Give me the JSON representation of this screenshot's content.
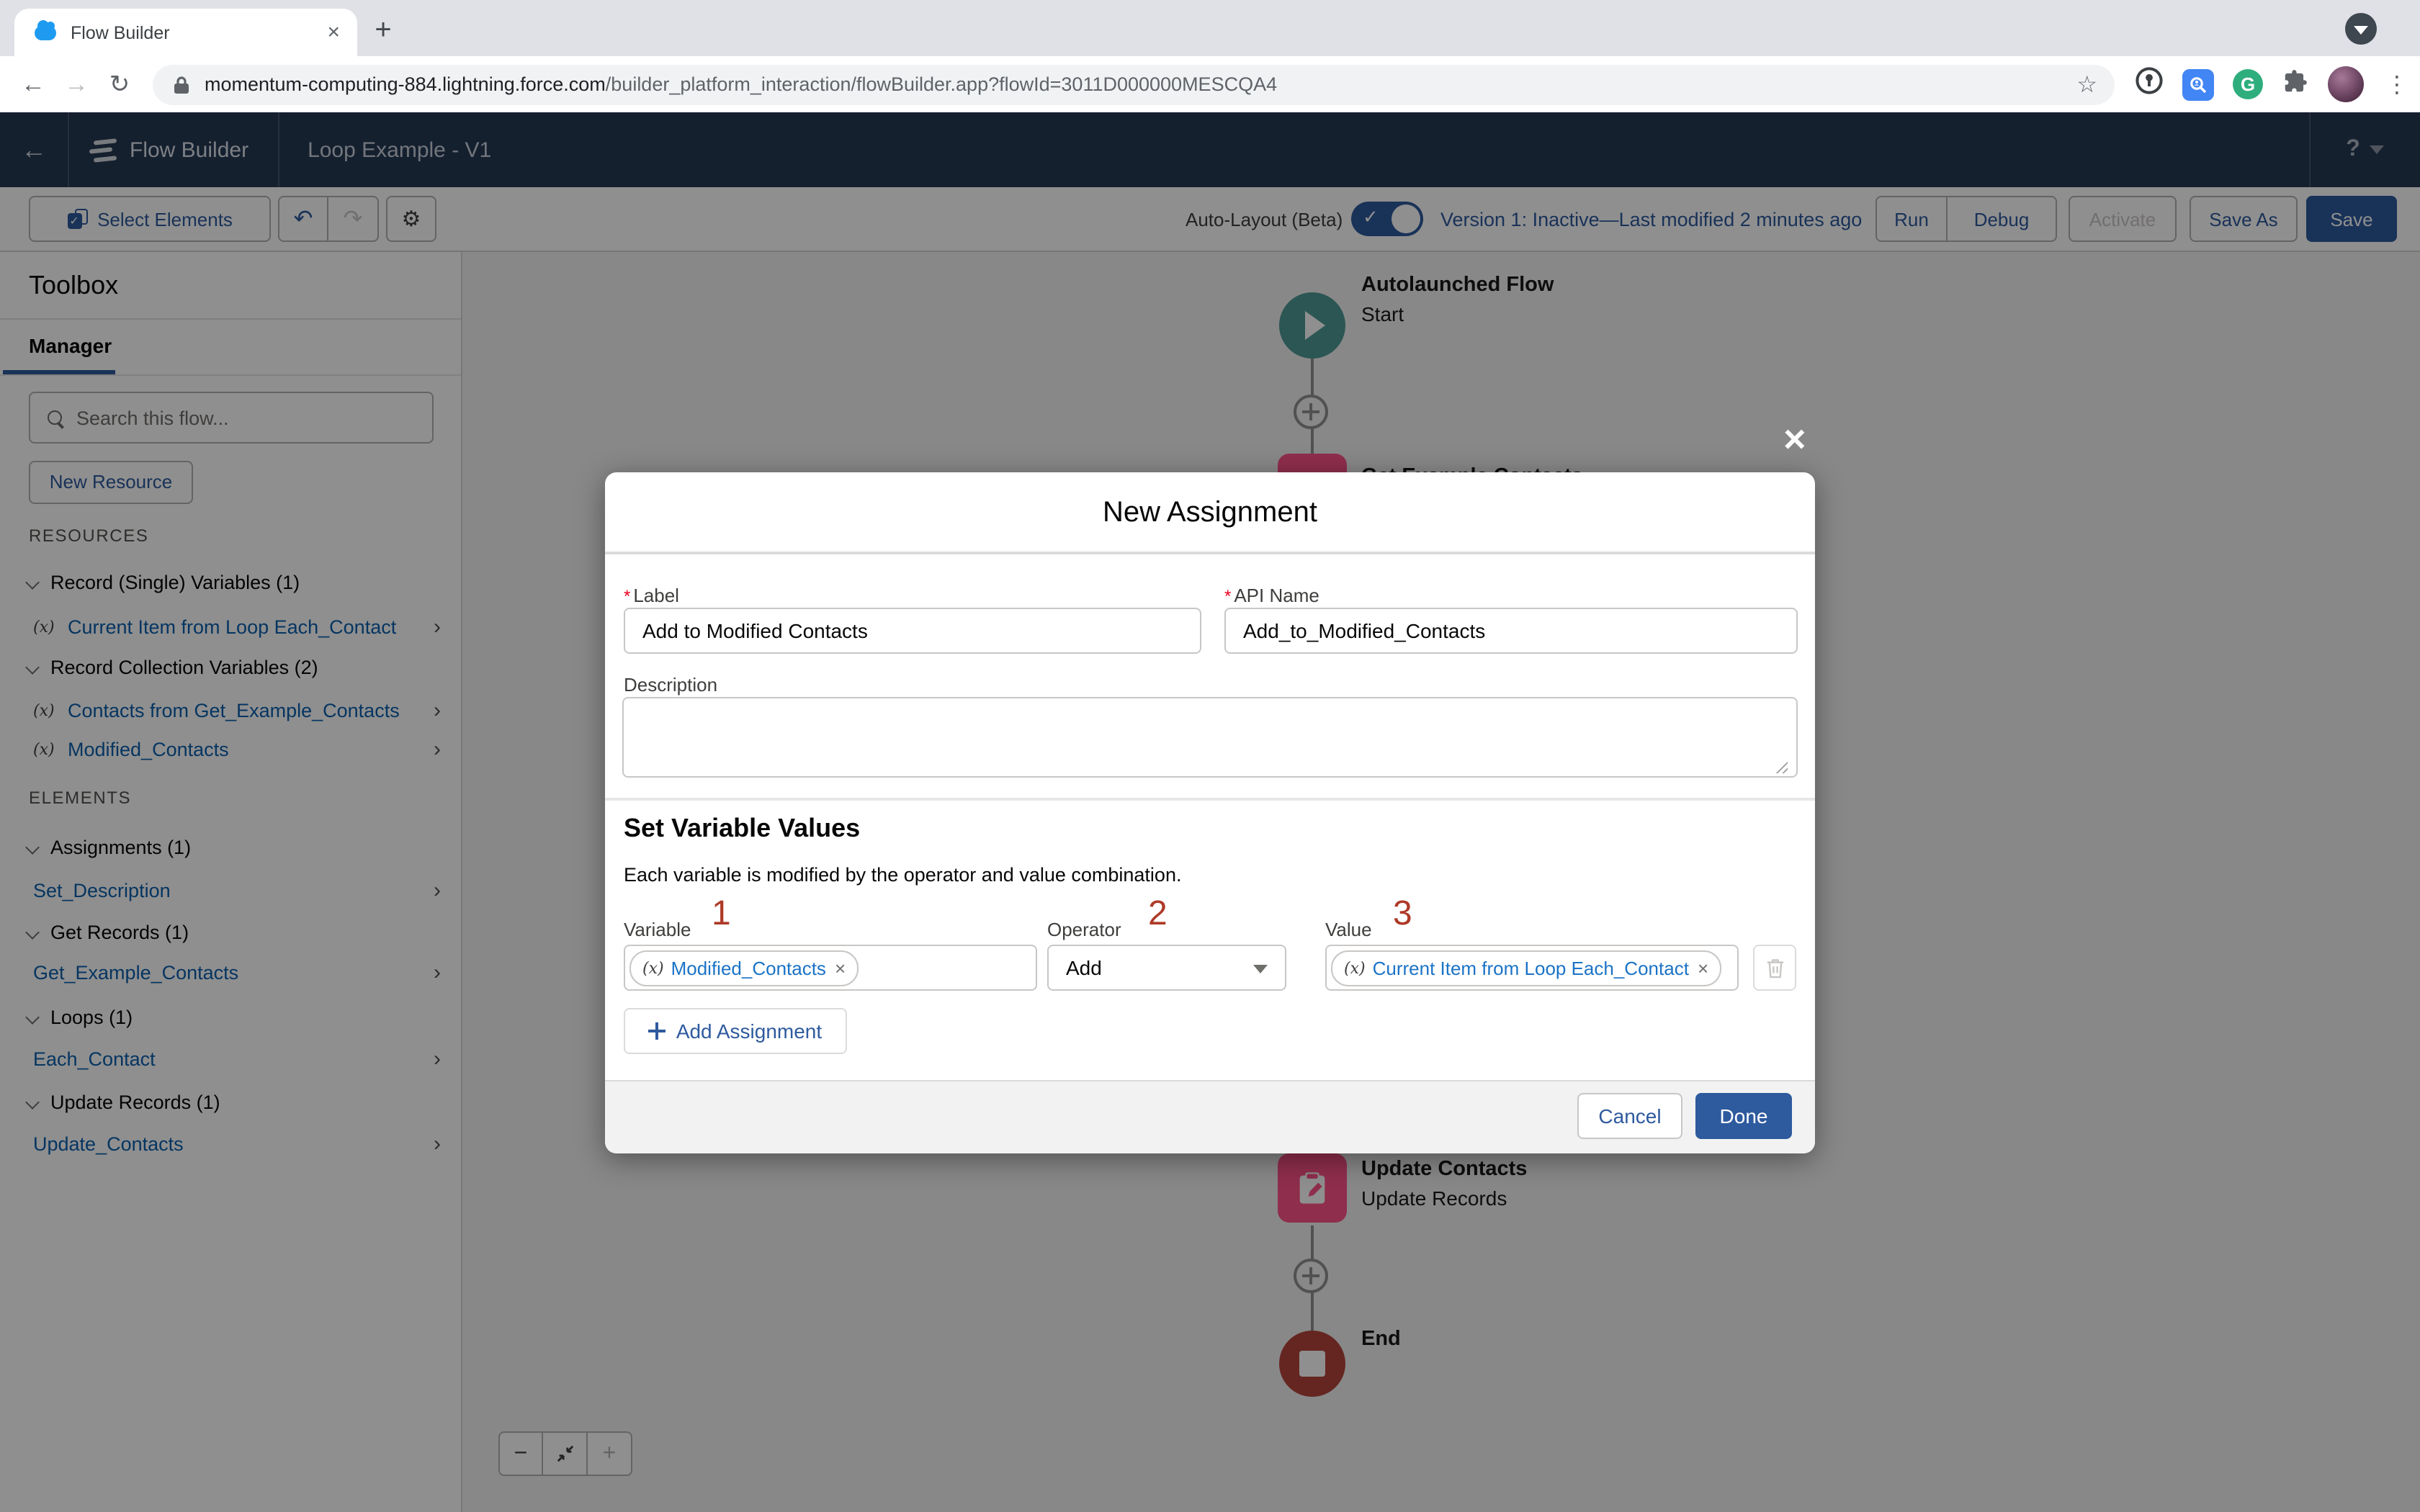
{
  "browser": {
    "tab_title": "Flow Builder",
    "url_domain": "momentum-computing-884.lightning.force.com",
    "url_path": "/builder_platform_interaction/flowBuilder.app?flowId=3011D000000MESCQA4"
  },
  "icons": {
    "close": "×",
    "plus": "+",
    "back": "←",
    "forward": "→",
    "reload": "↻",
    "star": "☆",
    "kebab": "⋮",
    "undo": "↶",
    "redo": "↷",
    "gear": "⚙",
    "grammarly_g": "G",
    "minus": "−"
  },
  "header": {
    "app_name": "Flow Builder",
    "flow_name": "Loop Example - V1",
    "help": "?"
  },
  "toolbar": {
    "select_elements": "Select Elements",
    "auto_layout": "Auto-Layout (Beta)",
    "version_text": "Version 1: Inactive—Last modified 2 minutes ago",
    "run": "Run",
    "debug": "Debug",
    "activate": "Activate",
    "save_as": "Save As",
    "save": "Save"
  },
  "sidebar": {
    "title": "Toolbox",
    "tab": "Manager",
    "search_placeholder": "Search this flow...",
    "new_resource": "New Resource",
    "resources_header": "RESOURCES",
    "elements_header": "ELEMENTS",
    "var_icon": "(x)",
    "chevron": "›",
    "groups": [
      {
        "header": "Record (Single) Variables (1)",
        "items": [
          {
            "label": "Current Item from Loop Each_Contact"
          }
        ]
      },
      {
        "header": "Record Collection Variables (2)",
        "items": [
          {
            "label": "Contacts from Get_Example_Contacts"
          },
          {
            "label": "Modified_Contacts"
          }
        ]
      }
    ],
    "element_groups": [
      {
        "header": "Assignments (1)",
        "items": [
          {
            "label": "Set_Description"
          }
        ]
      },
      {
        "header": "Get Records (1)",
        "items": [
          {
            "label": "Get_Example_Contacts"
          }
        ]
      },
      {
        "header": "Loops (1)",
        "items": [
          {
            "label": "Each_Contact"
          }
        ]
      },
      {
        "header": "Update Records (1)",
        "items": [
          {
            "label": "Update_Contacts"
          }
        ]
      }
    ]
  },
  "canvas": {
    "start": {
      "title": "Autolaunched Flow",
      "subtitle": "Start"
    },
    "get_node": {
      "title": "Get Example Contacts"
    },
    "update_node": {
      "title": "Update Contacts",
      "subtitle": "Update Records"
    },
    "end_node": {
      "title": "End"
    }
  },
  "modal": {
    "title": "New Assignment",
    "required_marker": "*",
    "label_field": {
      "label": "Label",
      "value": "Add to Modified Contacts"
    },
    "api_field": {
      "label": "API Name",
      "value": "Add_to_Modified_Contacts"
    },
    "description_label": "Description",
    "section_heading": "Set Variable Values",
    "helper": "Each variable is modified by the operator and value combination.",
    "annotations": {
      "one": "1",
      "two": "2",
      "three": "3"
    },
    "variable": {
      "label": "Variable",
      "pill": "Modified_Contacts",
      "icon": "(x)"
    },
    "operator": {
      "label": "Operator",
      "value": "Add"
    },
    "value": {
      "label": "Value",
      "pill": "Current Item from Loop Each_Contact",
      "icon": "(x)"
    },
    "add_assignment": "Add Assignment",
    "cancel": "Cancel",
    "done": "Done"
  },
  "colors": {
    "brand": "#2e5a9e",
    "link_blue": "#1b73c6",
    "data_pink": "#ff538a",
    "start_teal": "#4e9a94",
    "end_red": "#b5453b",
    "annotation_red": "#ae3a28"
  }
}
